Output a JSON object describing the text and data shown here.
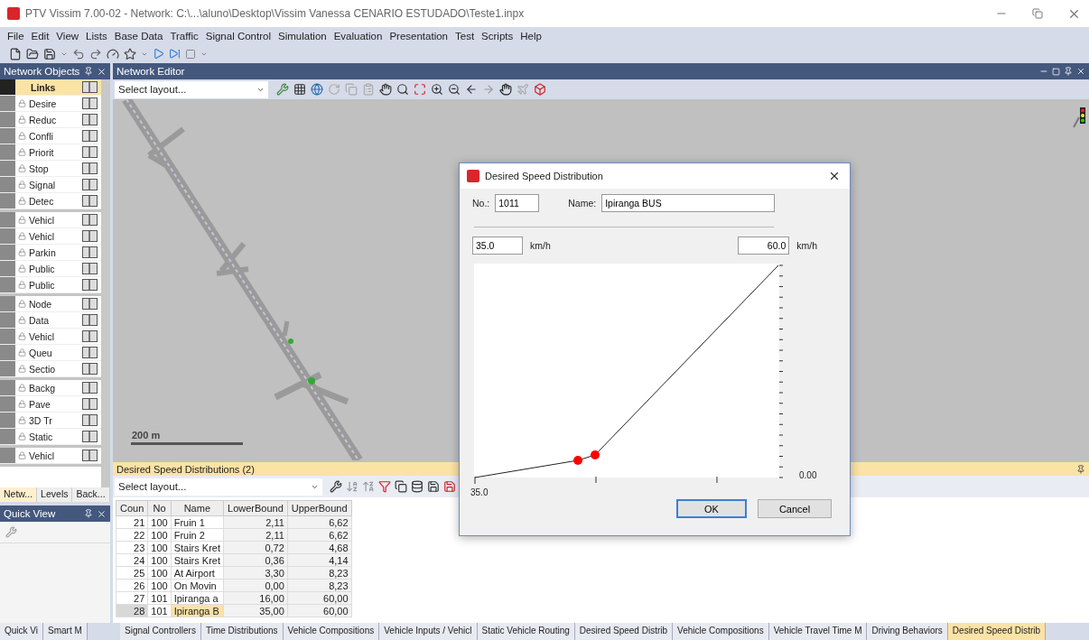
{
  "window": {
    "title": "PTV Vissim 7.00-02 - Network: C:\\...\\aluno\\Desktop\\Vissim Vanessa CENARIO ESTUDADO\\Teste1.inpx"
  },
  "menu": [
    "File",
    "Edit",
    "View",
    "Lists",
    "Base Data",
    "Traffic",
    "Signal Control",
    "Simulation",
    "Evaluation",
    "Presentation",
    "Test",
    "Scripts",
    "Help"
  ],
  "network_objects": {
    "title": "Network Objects",
    "groups": [
      {
        "items": [
          {
            "label": "Links",
            "selected": true
          },
          {
            "label": "Desire",
            "selected": false
          },
          {
            "label": "Reduc",
            "selected": false
          },
          {
            "label": "Confli",
            "selected": false
          },
          {
            "label": "Priorit",
            "selected": false
          },
          {
            "label": "Stop",
            "selected": false
          },
          {
            "label": "Signal",
            "selected": false
          },
          {
            "label": "Detec",
            "selected": false
          }
        ]
      },
      {
        "items": [
          {
            "label": "Vehicl",
            "selected": false
          },
          {
            "label": "Vehicl",
            "selected": false
          },
          {
            "label": "Parkin",
            "selected": false
          },
          {
            "label": "Public",
            "selected": false
          },
          {
            "label": "Public",
            "selected": false
          }
        ]
      },
      {
        "items": [
          {
            "label": "Node",
            "selected": false
          },
          {
            "label": "Data",
            "selected": false
          },
          {
            "label": "Vehicl",
            "selected": false
          },
          {
            "label": "Queu",
            "selected": false
          },
          {
            "label": "Sectio",
            "selected": false
          }
        ]
      },
      {
        "items": [
          {
            "label": "Backg",
            "selected": false
          },
          {
            "label": "Pave",
            "selected": false
          },
          {
            "label": "3D Tr",
            "selected": false
          },
          {
            "label": "Static",
            "selected": false
          }
        ]
      },
      {
        "items": [
          {
            "label": "Vehicl",
            "selected": false
          }
        ]
      }
    ],
    "tabs": [
      {
        "label": "Netw...",
        "selected": true
      },
      {
        "label": "Levels",
        "selected": false
      },
      {
        "label": "Back...",
        "selected": false
      }
    ]
  },
  "quick_view": {
    "title": "Quick View"
  },
  "network_editor": {
    "title": "Network Editor",
    "layout_select": "Select layout...",
    "scale_label": "200 m"
  },
  "list_panel": {
    "title": "Desired Speed Distributions (2)",
    "layout_select": "Select layout...",
    "columns": [
      "Coun",
      "No",
      "Name",
      "LowerBound",
      "UpperBound"
    ],
    "rows": [
      {
        "cells": [
          "21",
          "100",
          "Fruin 1",
          "2,11",
          "6,62"
        ],
        "selected": false
      },
      {
        "cells": [
          "22",
          "100",
          "Fruin 2",
          "2,11",
          "6,62"
        ],
        "selected": false
      },
      {
        "cells": [
          "23",
          "100",
          "Stairs Kret",
          "0,72",
          "4,68"
        ],
        "selected": false
      },
      {
        "cells": [
          "24",
          "100",
          "Stairs Kret",
          "0,36",
          "4,14"
        ],
        "selected": false
      },
      {
        "cells": [
          "25",
          "100",
          "At Airport",
          "3,30",
          "8,23"
        ],
        "selected": false
      },
      {
        "cells": [
          "26",
          "100",
          "On Movin",
          "0,00",
          "8,23"
        ],
        "selected": false
      },
      {
        "cells": [
          "27",
          "101",
          "Ipiranga a",
          "16,00",
          "60,00"
        ],
        "selected": false
      },
      {
        "cells": [
          "28",
          "101",
          "Ipiranga B",
          "35,00",
          "60,00"
        ],
        "selected": true
      }
    ]
  },
  "bottom_tabs_left": [
    {
      "label": "Quick Vi",
      "selected": false
    },
    {
      "label": "Smart M",
      "selected": false
    }
  ],
  "bottom_tabs": [
    {
      "label": "Signal Controllers",
      "selected": false
    },
    {
      "label": "Time Distributions",
      "selected": false
    },
    {
      "label": "Vehicle Compositions",
      "selected": false
    },
    {
      "label": "Vehicle Inputs / Vehicl",
      "selected": false
    },
    {
      "label": "Static Vehicle Routing",
      "selected": false
    },
    {
      "label": "Desired Speed Distrib",
      "selected": false
    },
    {
      "label": "Vehicle Compositions",
      "selected": false
    },
    {
      "label": "Vehicle Travel Time M",
      "selected": false
    },
    {
      "label": "Driving Behaviors",
      "selected": false
    },
    {
      "label": "Desired Speed Distrib",
      "selected": true
    }
  ],
  "dialog": {
    "title": "Desired Speed Distribution",
    "number_label": "No.:",
    "number": "1011",
    "name_label": "Name:",
    "name": "Ipiranga BUS",
    "min_speed": "35.0",
    "min_unit": "km/h",
    "max_speed": "60.0",
    "max_unit": "km/h",
    "x_axis_label": "35.0",
    "y_axis_label": "0.00",
    "buttons": [
      {
        "label": "OK",
        "default": true
      },
      {
        "label": "Cancel",
        "default": false
      }
    ]
  }
}
